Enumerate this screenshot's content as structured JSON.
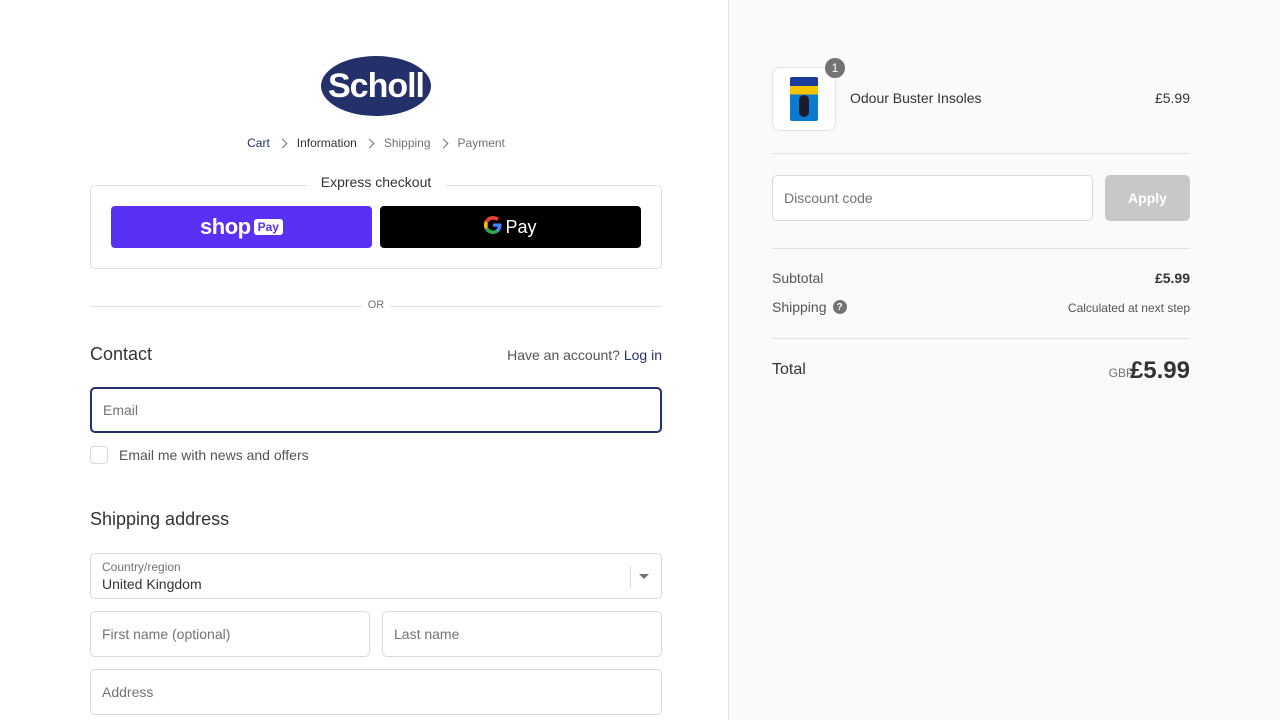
{
  "brand": {
    "logo_text": "Scholl"
  },
  "breadcrumb": [
    "Cart",
    "Information",
    "Shipping",
    "Payment"
  ],
  "express": {
    "title": "Express checkout",
    "shop_pay": {
      "shop": "shop",
      "pay": "Pay"
    },
    "gpay": {
      "g": "G",
      "pay": "Pay"
    }
  },
  "divider": {
    "or": "OR"
  },
  "contact": {
    "title": "Contact",
    "have_account": "Have an account?",
    "login": "Log in",
    "email_placeholder": "Email",
    "newsletter_label": "Email me with news and offers"
  },
  "shipping": {
    "title": "Shipping address",
    "country_label": "Country/region",
    "country_value": "United Kingdom",
    "first_name_placeholder": "First name (optional)",
    "last_name_placeholder": "Last name",
    "address_placeholder": "Address"
  },
  "summary": {
    "product": {
      "name": "Odour Buster Insoles",
      "price": "£5.99",
      "quantity": "1"
    },
    "discount_placeholder": "Discount code",
    "apply_label": "Apply",
    "subtotal_label": "Subtotal",
    "subtotal_value": "£5.99",
    "shipping_label": "Shipping",
    "shipping_value": "Calculated at next step",
    "total_label": "Total",
    "currency": "GBP",
    "total_value": "£5.99"
  },
  "icons": {
    "help": "help-icon",
    "caret": "chevron-down-icon",
    "chevron": "chevron-right-icon"
  },
  "colors": {
    "brand": "#24306a",
    "shop_pay": "#5a31f4",
    "gpay": "#000000"
  }
}
